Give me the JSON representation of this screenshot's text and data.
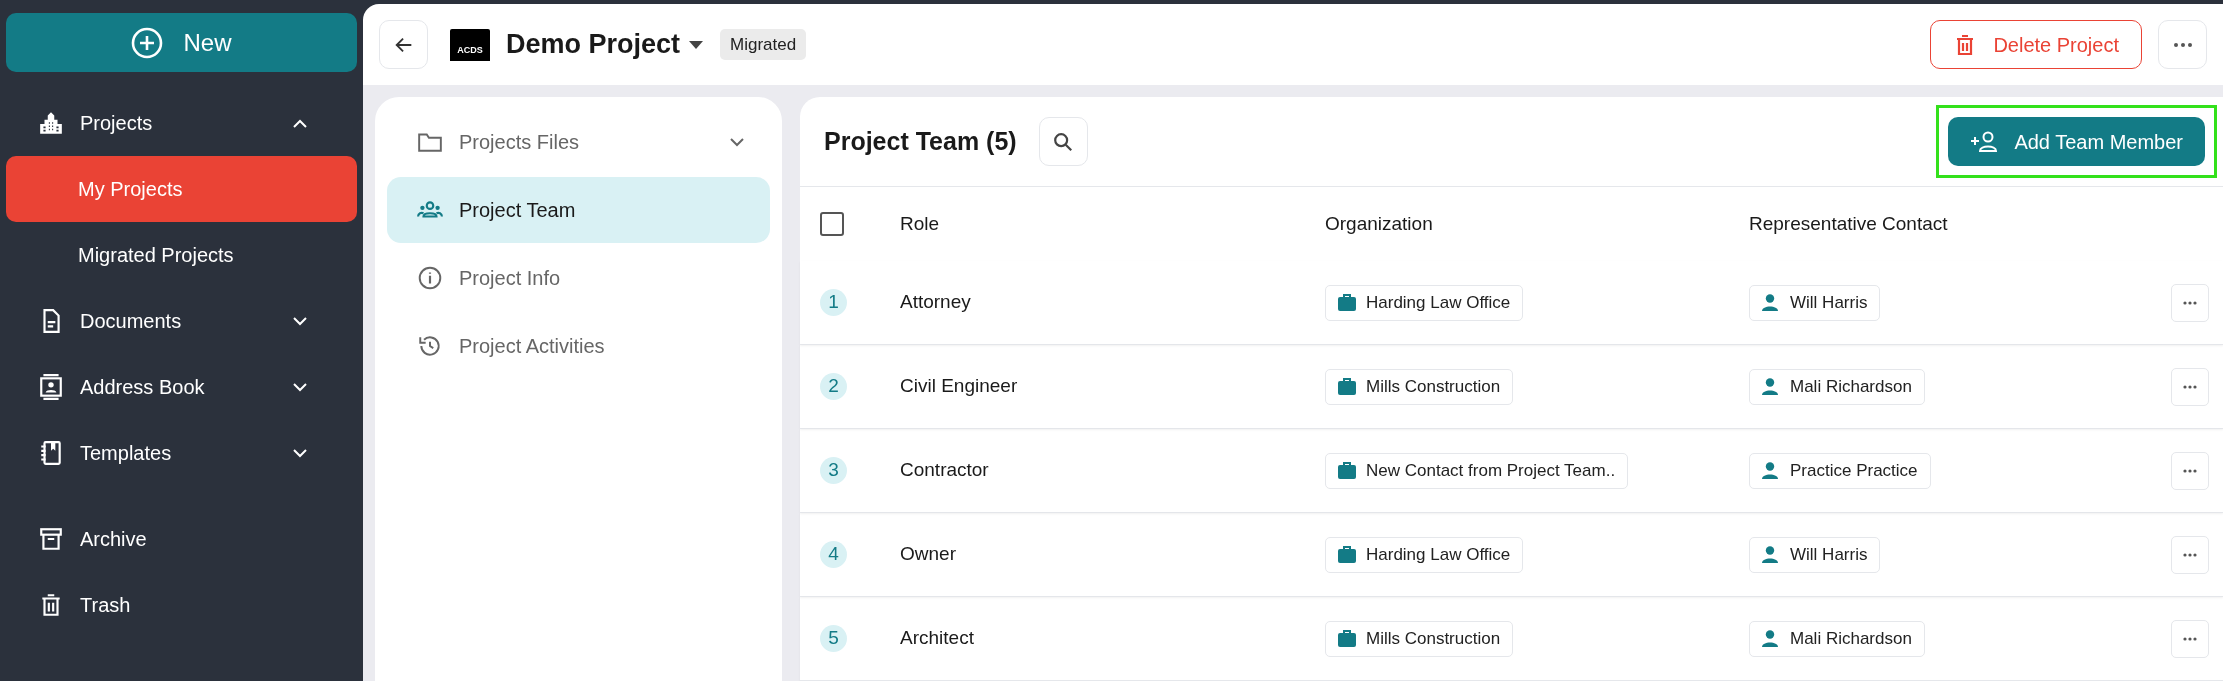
{
  "sidebar": {
    "new_button": "New",
    "items": [
      {
        "kind": "group",
        "label": "Projects",
        "expanded": true,
        "children": [
          {
            "label": "My Projects",
            "selected": true
          },
          {
            "label": "Migrated Projects",
            "selected": false
          }
        ]
      },
      {
        "kind": "group",
        "label": "Documents",
        "expanded": false
      },
      {
        "kind": "group",
        "label": "Address Book",
        "expanded": false
      },
      {
        "kind": "group",
        "label": "Templates",
        "expanded": false
      },
      {
        "kind": "link",
        "label": "Archive"
      },
      {
        "kind": "link",
        "label": "Trash"
      }
    ]
  },
  "header": {
    "logo_text": "ACDS",
    "title": "Demo Project",
    "badge": "Migrated",
    "delete_button": "Delete Project"
  },
  "project_nav": [
    {
      "label": "Projects Files",
      "selected": false,
      "expandable": true
    },
    {
      "label": "Project Team",
      "selected": true,
      "expandable": false
    },
    {
      "label": "Project Info",
      "selected": false,
      "expandable": false
    },
    {
      "label": "Project Activities",
      "selected": false,
      "expandable": false
    }
  ],
  "team": {
    "title": "Project Team (5)",
    "add_button": "Add Team Member",
    "highlighted": true,
    "select_all": false,
    "columns": [
      "Role",
      "Organization",
      "Representative Contact"
    ],
    "rows": [
      {
        "index": "1",
        "role": "Attorney",
        "organization": "Harding Law Office",
        "contact": "Will Harris"
      },
      {
        "index": "2",
        "role": "Civil Engineer",
        "organization": "Mills Construction",
        "contact": "Mali Richardson"
      },
      {
        "index": "3",
        "role": "Contractor",
        "organization": "New Contact from Project Team..",
        "contact": "Practice Practice"
      },
      {
        "index": "4",
        "role": "Owner",
        "organization": "Harding Law Office",
        "contact": "Will Harris"
      },
      {
        "index": "5",
        "role": "Architect",
        "organization": "Mills Construction",
        "contact": "Mali Richardson"
      }
    ]
  }
}
